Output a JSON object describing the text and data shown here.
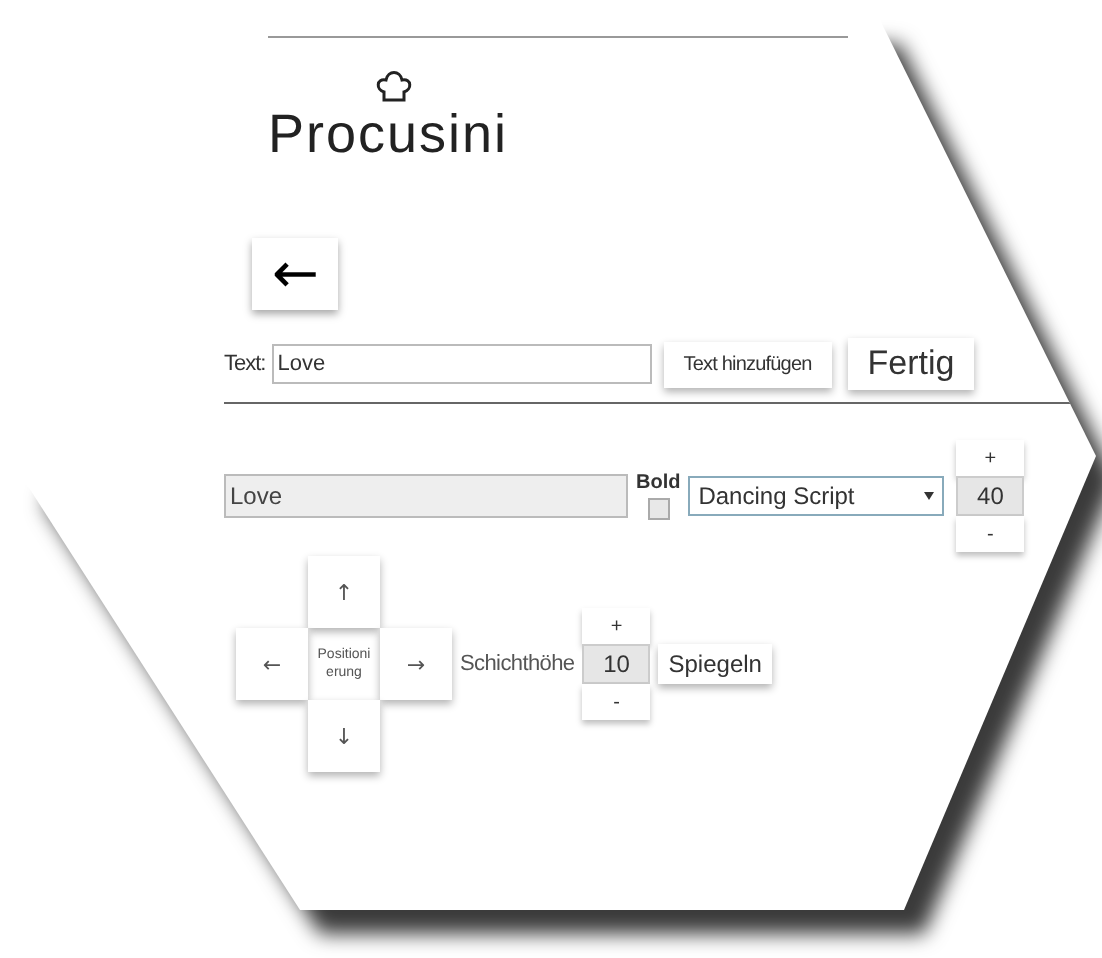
{
  "logo": "Procusini",
  "back_button": "←",
  "text_input": {
    "label": "Text:",
    "value": "Love"
  },
  "add_text_button": "Text hinzufügen",
  "done_button": "Fertig",
  "layer": {
    "value": "Love",
    "bold_label": "Bold",
    "bold": false,
    "font": "Dancing Script",
    "size_plus": "+",
    "size": "40",
    "size_minus": "-"
  },
  "position": {
    "up": "↑",
    "left": "←",
    "label": "Positioni erung",
    "right": "→",
    "down": "↓"
  },
  "layer_height": {
    "label": "Schichthöhe",
    "plus": "+",
    "value": "10",
    "minus": "-"
  },
  "mirror_button": "Spiegeln"
}
